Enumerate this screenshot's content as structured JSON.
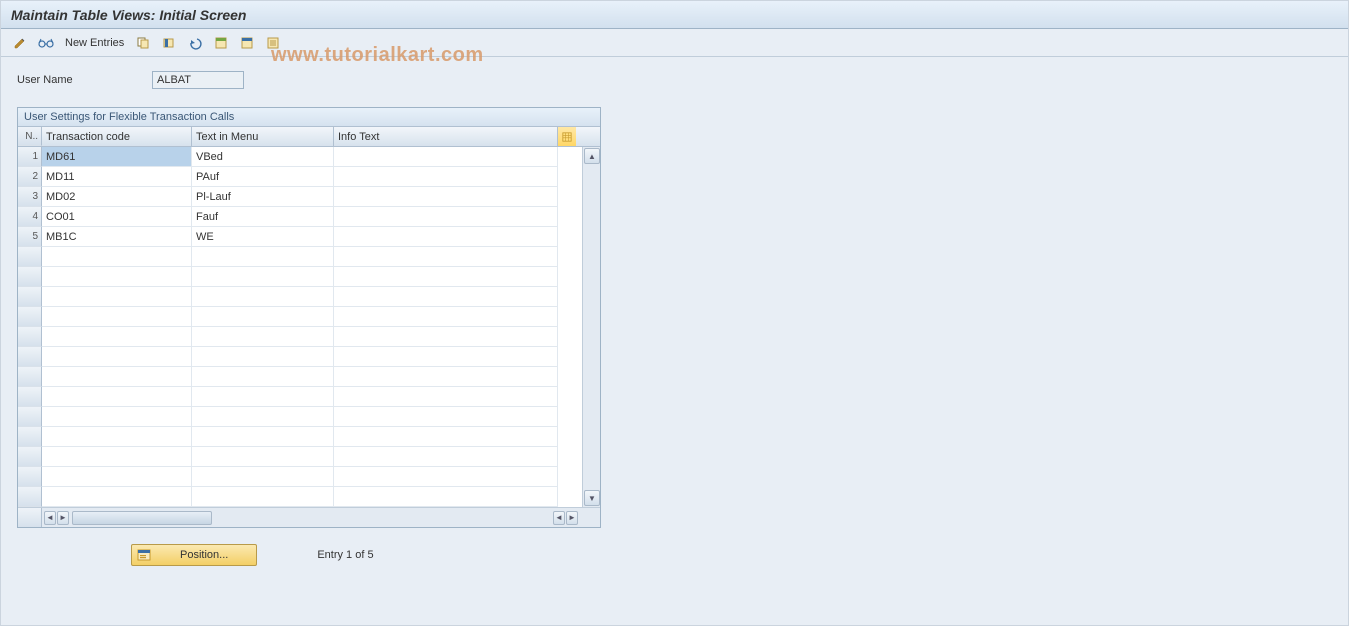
{
  "title": "Maintain Table Views: Initial Screen",
  "watermark": "www.tutorialkart.com",
  "toolbar": {
    "new_entries_label": "New Entries"
  },
  "form": {
    "user_name_label": "User Name",
    "user_name_value": "ALBAT"
  },
  "table": {
    "caption": "User Settings for Flexible Transaction Calls",
    "columns": {
      "n": "N..",
      "transaction_code": "Transaction code",
      "text_in_menu": "Text in Menu",
      "info_text": "Info Text"
    },
    "rows": [
      {
        "n": "1",
        "tc": "MD61",
        "tm": "VBed",
        "it": ""
      },
      {
        "n": "2",
        "tc": "MD11",
        "tm": "PAuf",
        "it": ""
      },
      {
        "n": "3",
        "tc": "MD02",
        "tm": "Pl-Lauf",
        "it": ""
      },
      {
        "n": "4",
        "tc": "CO01",
        "tm": "Fauf",
        "it": ""
      },
      {
        "n": "5",
        "tc": "MB1C",
        "tm": "WE",
        "it": ""
      }
    ],
    "empty_rows": 13
  },
  "footer": {
    "position_label": "Position...",
    "entry_text": "Entry 1 of 5"
  }
}
